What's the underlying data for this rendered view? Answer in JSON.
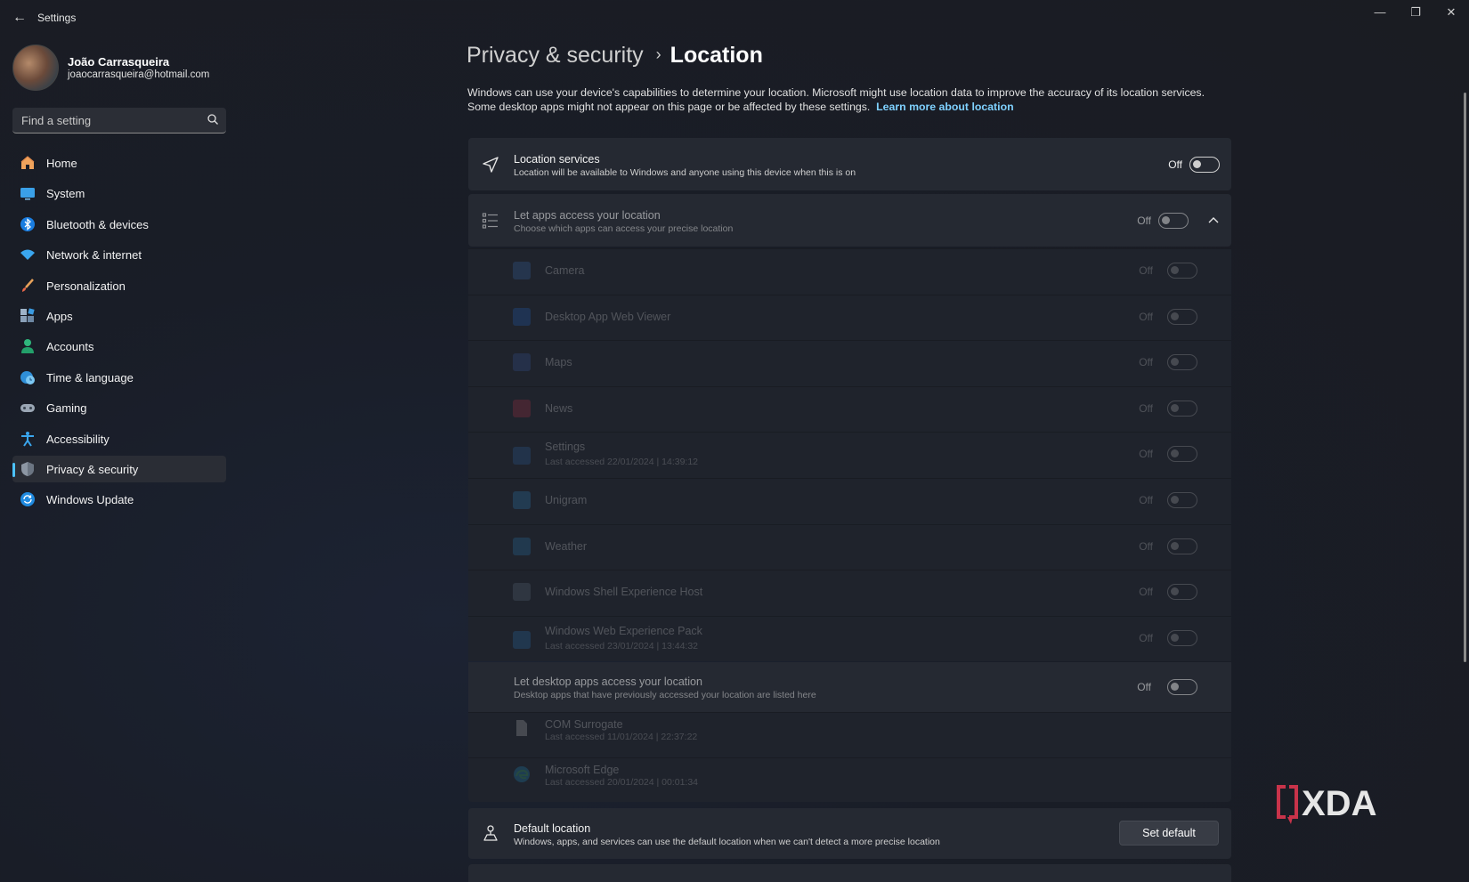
{
  "window": {
    "title": "Settings",
    "back_glyph": "←",
    "minimize_glyph": "—",
    "restore_glyph": "❐",
    "close_glyph": "✕"
  },
  "profile": {
    "name": "João Carrasqueira",
    "email": "joaocarrasqueira@hotmail.com"
  },
  "search": {
    "placeholder": "Find a setting"
  },
  "sidebar": {
    "items": [
      {
        "label": "Home",
        "icon": "home-icon"
      },
      {
        "label": "System",
        "icon": "monitor-icon"
      },
      {
        "label": "Bluetooth & devices",
        "icon": "bluetooth-icon"
      },
      {
        "label": "Network & internet",
        "icon": "wifi-icon"
      },
      {
        "label": "Personalization",
        "icon": "brush-icon"
      },
      {
        "label": "Apps",
        "icon": "apps-icon"
      },
      {
        "label": "Accounts",
        "icon": "account-icon"
      },
      {
        "label": "Time & language",
        "icon": "globe-clock-icon"
      },
      {
        "label": "Gaming",
        "icon": "gamepad-icon"
      },
      {
        "label": "Accessibility",
        "icon": "accessibility-icon"
      },
      {
        "label": "Privacy & security",
        "icon": "shield-icon",
        "active": true
      },
      {
        "label": "Windows Update",
        "icon": "update-icon"
      }
    ]
  },
  "breadcrumb": {
    "parent": "Privacy & security",
    "separator": "›",
    "current": "Location"
  },
  "intro": {
    "text": "Windows can use your device's capabilities to determine your location. Microsoft might use location data to improve the accuracy of its location services. Some desktop apps might not appear on this page or be affected by these settings.",
    "link": "Learn more about location"
  },
  "location_services": {
    "title": "Location services",
    "subtitle": "Location will be available to Windows and anyone using this device when this is on",
    "state": "Off"
  },
  "app_access": {
    "title": "Let apps access your location",
    "subtitle": "Choose which apps can access your precise location",
    "state": "Off"
  },
  "apps": [
    {
      "name": "Camera",
      "sub": "",
      "state": "Off",
      "icon": "camera-icon",
      "color": "#3b78c4"
    },
    {
      "name": "Desktop App Web Viewer",
      "sub": "",
      "state": "Off",
      "icon": "web-viewer-icon",
      "color": "#1f6fd8"
    },
    {
      "name": "Maps",
      "sub": "",
      "state": "Off",
      "icon": "maps-icon",
      "color": "#3a5fb0"
    },
    {
      "name": "News",
      "sub": "",
      "state": "Off",
      "icon": "news-icon",
      "color": "#c8334a"
    },
    {
      "name": "Settings",
      "sub": "Last accessed 22/01/2024  |  14:39:12",
      "state": "Off",
      "icon": "gear-icon",
      "color": "#2f6db3"
    },
    {
      "name": "Unigram",
      "sub": "",
      "state": "Off",
      "icon": "telegram-icon",
      "color": "#2e8fd4"
    },
    {
      "name": "Weather",
      "sub": "",
      "state": "Off",
      "icon": "weather-icon",
      "color": "#2c86c9"
    },
    {
      "name": "Windows Shell Experience Host",
      "sub": "",
      "state": "Off",
      "icon": "shell-host-icon",
      "color": "#6a7a8c"
    },
    {
      "name": "Windows Web Experience Pack",
      "sub": "Last accessed 23/01/2024  |  13:44:32",
      "state": "Off",
      "icon": "web-experience-icon",
      "color": "#2a7fc8"
    }
  ],
  "desktop_access": {
    "title": "Let desktop apps access your location",
    "subtitle": "Desktop apps that have previously accessed your location are listed here",
    "state": "Off"
  },
  "desktop_apps": [
    {
      "name": "COM Surrogate",
      "sub": "Last accessed 11/01/2024  |  22:37:22",
      "icon": "file-icon"
    },
    {
      "name": "Microsoft Edge",
      "sub": "Last accessed 20/01/2024  |  00:01:34",
      "icon": "edge-icon"
    }
  ],
  "default_location": {
    "title": "Default location",
    "subtitle": "Windows, apps, and services can use the default location when we can't detect a more precise location",
    "button": "Set default"
  },
  "watermark": {
    "text": "XDA"
  }
}
